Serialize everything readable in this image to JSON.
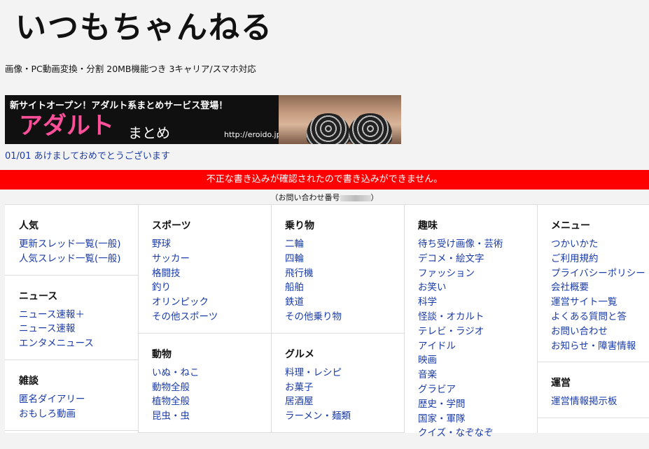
{
  "header": {
    "logo": "いつもちゃんねる",
    "tagline": "画像・PC動画変換・分割 20MB機能つき 3キャリア/スマホ対応"
  },
  "banner": {
    "headline": "新サイトオープン！アダルト系まとめサービス登場！",
    "main": "アダルト",
    "sub": "まとめ",
    "url": "http://eroido.jp"
  },
  "notice": "01/01 あけましておめでとうございます",
  "error": {
    "message": "不正な書き込みが確認されたので書き込みができません。",
    "inquiry_prefix": "（お問い合わせ番号",
    "inquiry_suffix": "）"
  },
  "columns": [
    [
      {
        "head": "人気",
        "items": [
          "更新スレッド一覧(一般)",
          "人気スレッド一覧(一般)"
        ]
      },
      {
        "head": "ニュース",
        "items": [
          "ニュース速報＋",
          "ニュース速報",
          "エンタメニュース"
        ]
      },
      {
        "head": "雑談",
        "items": [
          "匿名ダイアリー",
          "おもしろ動画"
        ]
      }
    ],
    [
      {
        "head": "スポーツ",
        "items": [
          "野球",
          "サッカー",
          "格闘技",
          "釣り",
          "オリンピック",
          "その他スポーツ"
        ]
      },
      {
        "head": "動物",
        "items": [
          "いぬ・ねこ",
          "動物全般",
          "植物全般",
          "昆虫・虫"
        ]
      }
    ],
    [
      {
        "head": "乗り物",
        "items": [
          "二輪",
          "四輪",
          "飛行機",
          "船舶",
          "鉄道",
          "その他乗り物"
        ]
      },
      {
        "head": "グルメ",
        "items": [
          "料理・レシピ",
          "お菓子",
          "居酒屋",
          "ラーメン・麺類"
        ]
      }
    ],
    [
      {
        "head": "趣味",
        "items": [
          "待ち受け画像・芸術",
          "デコメ・絵文字",
          "ファッション",
          "お笑い",
          "科学",
          "怪談・オカルト",
          "テレビ・ラジオ",
          "アイドル",
          "映画",
          "音楽",
          "グラビア",
          "歴史・学問",
          "国家・軍隊",
          "クイズ・なぞなぞ"
        ]
      }
    ],
    [
      {
        "head": "メニュー",
        "items": [
          "つかいかた",
          "ご利用規約",
          "プライバシーポリシー",
          "会社概要",
          "運営サイト一覧",
          "よくある質問と答",
          "お問い合わせ",
          "お知らせ・障害情報"
        ]
      },
      {
        "head": "運営",
        "items": [
          "運営情報掲示板"
        ]
      }
    ]
  ]
}
